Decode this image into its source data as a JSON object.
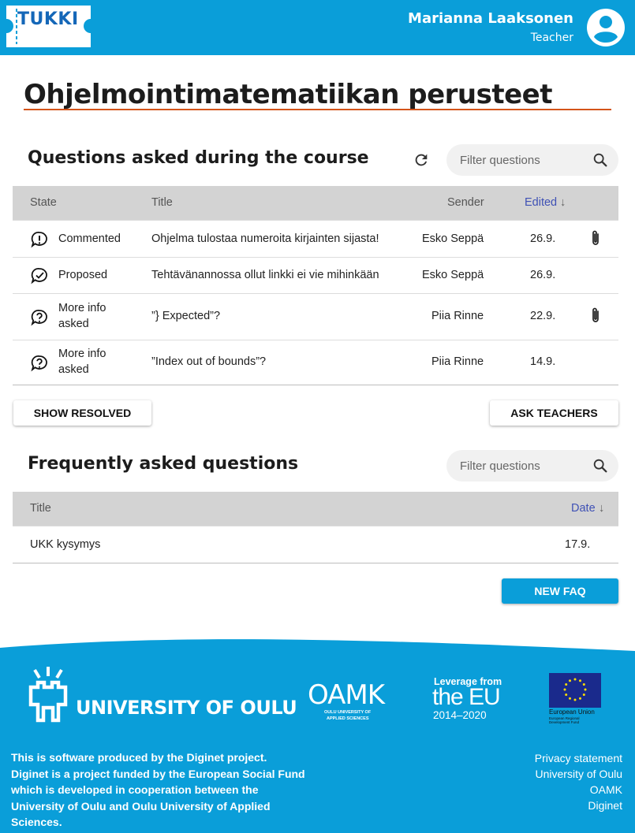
{
  "header": {
    "logo_text": "TUKKI",
    "user_name": "Marianna Laaksonen",
    "user_role": "Teacher"
  },
  "course": {
    "title": "Ohjelmointimatematiikan perusteet"
  },
  "questions": {
    "title": "Questions asked during the course",
    "filter_placeholder": "Filter questions",
    "columns": {
      "state": "State",
      "title": "Title",
      "sender": "Sender",
      "edited": "Edited"
    },
    "sort_arrow": "↓",
    "rows": [
      {
        "state": "Commented",
        "title": "Ohjelma tulostaa numeroita kirjainten sijasta!",
        "sender": "Esko Seppä",
        "edited": "26.9.",
        "state_icon": "exclamation-circle-icon",
        "attachment": true
      },
      {
        "state": "Proposed",
        "title": "Tehtävänannossa ollut linkki ei vie mihinkään",
        "sender": "Esko Seppä",
        "edited": "26.9.",
        "state_icon": "check-circle-icon",
        "attachment": false
      },
      {
        "state_line1": "More info",
        "state_line2": "asked",
        "title": "”} Expected”?",
        "sender": "Piia Rinne",
        "edited": "22.9.",
        "state_icon": "question-circle-icon",
        "attachment": true
      },
      {
        "state_line1": "More info",
        "state_line2": "asked",
        "title": "”Index out of bounds”?",
        "sender": "Piia Rinne",
        "edited": "14.9.",
        "state_icon": "question-circle-icon",
        "attachment": false
      }
    ],
    "show_resolved_label": "SHOW RESOLVED",
    "ask_teachers_label": "ASK TEACHERS"
  },
  "faq": {
    "title": "Frequently asked questions",
    "filter_placeholder": "Filter questions",
    "columns": {
      "title": "Title",
      "date": "Date"
    },
    "sort_arrow": "↓",
    "rows": [
      {
        "title": "UKK kysymys",
        "date": "17.9."
      }
    ],
    "new_faq_label": "NEW FAQ"
  },
  "footer": {
    "university_logo_text": "UNIVERSITY OF OULU",
    "oamk_logo_text": "OAMK",
    "oamk_sub_line1": "OULU UNIVERSITY OF",
    "oamk_sub_line2": "APPLIED SCIENCES",
    "eu_leverage": "Leverage from",
    "eu_the_eu": "the EU",
    "eu_years": "2014–2020",
    "eu_flag_line1": "European Union",
    "eu_flag_line2": "European Regional",
    "eu_flag_line3": "Development Fund",
    "description": "This is software produced by the Diginet project. Diginet is a project funded by the European Social Fund which is developed in cooperation between the University of Oulu and Oulu University of Applied Sciences.",
    "links": [
      "Privacy statement",
      "University of Oulu",
      "OAMK",
      "Diginet"
    ]
  },
  "colors": {
    "brand_blue": "#0a9ed9",
    "accent_orange": "#d4541a",
    "sort_blue": "#3f51b5"
  }
}
